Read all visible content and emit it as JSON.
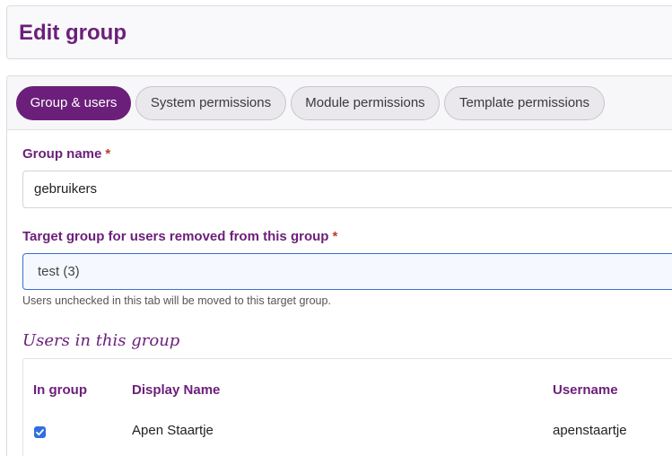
{
  "header": {
    "title": "Edit group"
  },
  "tabs": [
    {
      "label": "Group & users",
      "active": true
    },
    {
      "label": "System permissions",
      "active": false
    },
    {
      "label": "Module permissions",
      "active": false
    },
    {
      "label": "Template permissions",
      "active": false
    }
  ],
  "form": {
    "group_name": {
      "label": "Group name",
      "required_mark": "*",
      "value": "gebruikers"
    },
    "target_group": {
      "label": "Target group for users removed from this group",
      "required_mark": "*",
      "selected": "test (3)",
      "help": "Users unchecked in this tab will be moved to this target group."
    }
  },
  "users_section": {
    "title": "Users in this group",
    "columns": [
      "In group",
      "Display Name",
      "Username"
    ],
    "rows": [
      {
        "in_group": true,
        "display_name": "Apen Staartje",
        "username": "apenstaartje"
      }
    ]
  },
  "colors": {
    "accent": "#6b1f7a",
    "checkbox": "#2f6fe0",
    "required": "#c0392b"
  }
}
